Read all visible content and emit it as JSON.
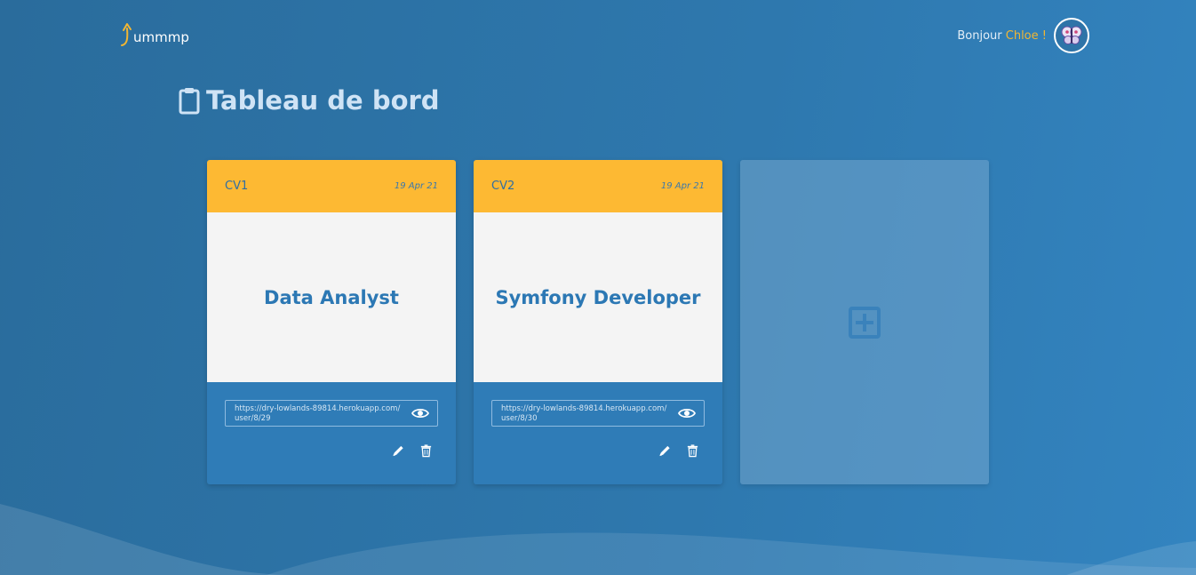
{
  "header": {
    "logo_text": "ummmp",
    "greeting_prefix": "Bonjour",
    "user_name": "Chloe",
    "greeting_suffix": "!"
  },
  "page": {
    "title": "Tableau de bord"
  },
  "cvs": [
    {
      "label": "CV1",
      "date": "19 Apr 21",
      "title": "Data Analyst",
      "link": "https://dry-lowlands-89814.herokuapp.com/user/8/29"
    },
    {
      "label": "CV2",
      "date": "19 Apr 21",
      "title": "Symfony Developer",
      "link": "https://dry-lowlands-89814.herokuapp.com/user/8/30"
    }
  ],
  "icons": {
    "logo": "jump-arrow-icon",
    "avatar": "butterfly-icon",
    "title": "clipboard-icon",
    "view": "eye-icon",
    "edit": "pencil-icon",
    "delete": "trash-icon",
    "add": "plus-square-icon"
  },
  "colors": {
    "accent": "#fdb933",
    "card_body": "#f4f4f4",
    "card_foot": "#2f7cb7",
    "title_text": "#2c78b4",
    "background": "#2e78ae"
  }
}
